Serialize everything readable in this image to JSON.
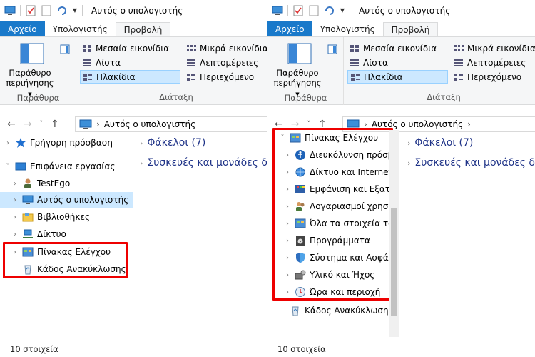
{
  "window_title": "Αυτός ο υπολογιστής",
  "menu": {
    "file": "Αρχείο",
    "computer": "Υπολογιστής",
    "view": "Προβολή"
  },
  "ribbon": {
    "preview_pane_line1": "Παράθυρο",
    "preview_pane_line2": "περιήγησης",
    "panes_group": "Παράθυρα",
    "layout_group": "Διάταξη",
    "medium_icons": "Μεσαία εικονίδια",
    "small_icons": "Μικρά εικονίδια",
    "list": "Λίστα",
    "details": "Λεπτομέρειες",
    "tiles": "Πλακίδια",
    "content": "Περιεχόμενο"
  },
  "address": {
    "path": "Αυτός ο υπολογιστής"
  },
  "left_nav": {
    "quick_access": "Γρήγορη πρόσβαση",
    "desktop": "Επιφάνεια εργασίας",
    "user": "TestEgo",
    "this_pc": "Αυτός ο υπολογιστής",
    "libraries": "Βιβλιοθήκες",
    "network": "Δίκτυο",
    "control_panel": "Πίνακας Ελέγχου",
    "recycle_bin": "Κάδος Ανακύκλωσης"
  },
  "right_nav": {
    "control_panel": "Πίνακας Ελέγχου",
    "children": [
      "Διευκόλυνση πρόσβ",
      "Δίκτυο και Internet",
      "Εμφάνιση και Εξατο",
      "Λογαριασμοί χρηστ",
      "Όλα τα στοιχεία του",
      "Προγράμματα",
      "Σύστημα και Ασφάλ",
      "Υλικό και Ήχος",
      "Ώρα και περιοχή"
    ],
    "recycle_bin": "Κάδος Ανακύκλωσης"
  },
  "content": {
    "folders": "Φάκελοι (7)",
    "devices": "Συσκευές και μονάδες δί"
  },
  "status": "10 στοιχεία",
  "colors": {
    "accent": "#1979ca",
    "highlight": "#e00000",
    "selection": "#cce8ff"
  }
}
